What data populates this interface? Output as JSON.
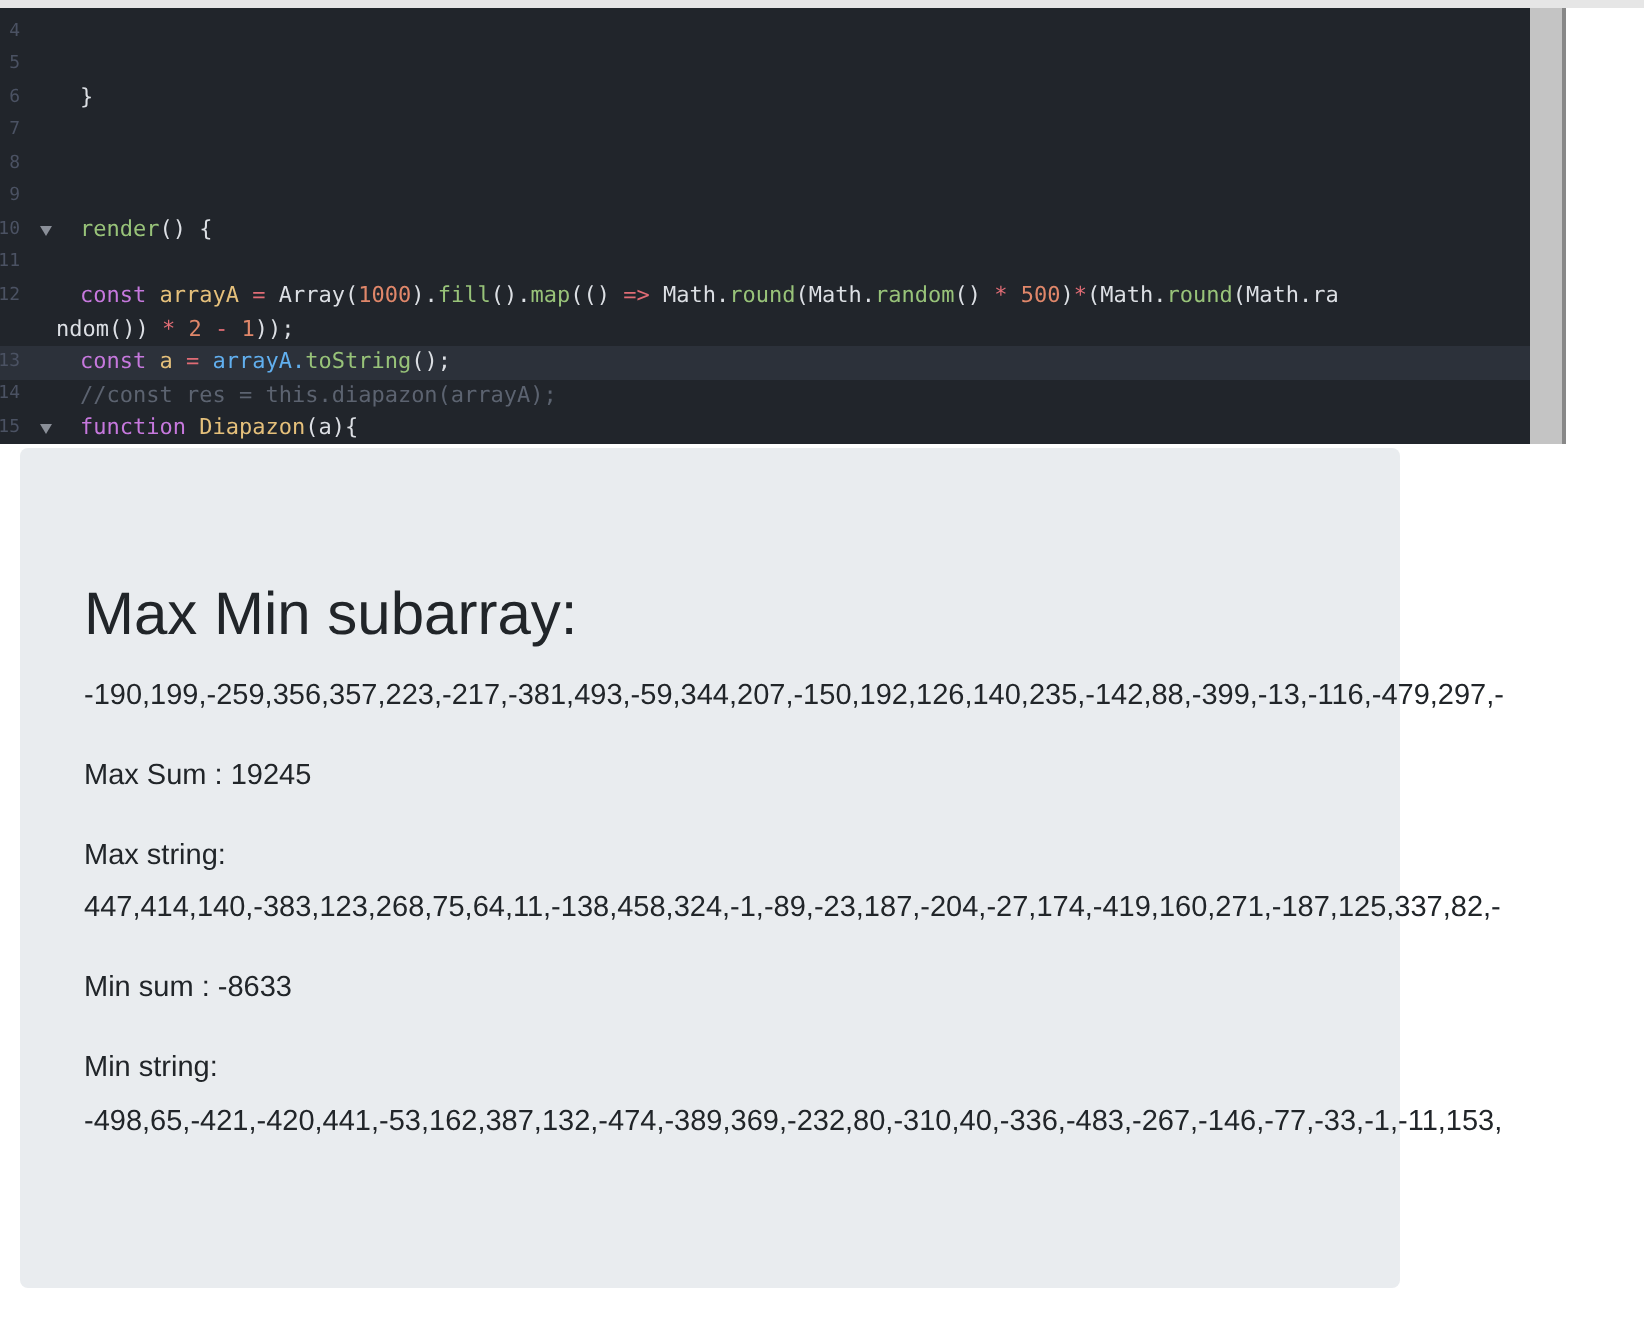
{
  "editor": {
    "lines": [
      {
        "number": "4",
        "fold": false,
        "active": false
      },
      {
        "number": "5",
        "fold": false,
        "active": false
      },
      {
        "number": "6",
        "fold": false,
        "active": false,
        "tokens": [
          {
            "text": "}",
            "kind": "plain"
          }
        ]
      },
      {
        "number": "7",
        "fold": false,
        "active": false
      },
      {
        "number": "8",
        "fold": false,
        "active": false
      },
      {
        "number": "9",
        "fold": false,
        "active": false
      },
      {
        "number": "10",
        "fold": true,
        "active": false,
        "tokens": [
          {
            "text": "render",
            "kind": "function"
          },
          {
            "text": "() {",
            "kind": "plain"
          }
        ]
      },
      {
        "number": "11",
        "fold": false,
        "active": false
      },
      {
        "number": "12",
        "fold": false,
        "active": false,
        "tokens": [
          {
            "text": "const",
            "kind": "keyword"
          },
          {
            "text": " arrayA",
            "kind": "variable"
          },
          {
            "text": " =",
            "kind": "operator"
          },
          {
            "text": " Array(",
            "kind": "plain"
          },
          {
            "text": "1000",
            "kind": "number"
          },
          {
            "text": ").",
            "kind": "plain"
          },
          {
            "text": "fill",
            "kind": "function"
          },
          {
            "text": "().",
            "kind": "plain"
          },
          {
            "text": "map",
            "kind": "function"
          },
          {
            "text": "(()",
            "kind": "plain"
          },
          {
            "text": " =>",
            "kind": "operator"
          },
          {
            "text": " Math.",
            "kind": "plain"
          },
          {
            "text": "round",
            "kind": "function"
          },
          {
            "text": "(Math.",
            "kind": "plain"
          },
          {
            "text": "random",
            "kind": "function"
          },
          {
            "text": "()",
            "kind": "plain"
          },
          {
            "text": " *",
            "kind": "operator"
          },
          {
            "text": " 500",
            "kind": "number"
          },
          {
            "text": ")",
            "kind": "plain"
          },
          {
            "text": "*",
            "kind": "operator"
          },
          {
            "text": "(Math.",
            "kind": "plain"
          },
          {
            "text": "round",
            "kind": "function"
          },
          {
            "text": "(Math.ra",
            "kind": "plain"
          }
        ],
        "wrap": [
          {
            "text": "ndom())",
            "kind": "plain"
          },
          {
            "text": " *",
            "kind": "operator"
          },
          {
            "text": " 2",
            "kind": "number"
          },
          {
            "text": " -",
            "kind": "operator"
          },
          {
            "text": " 1",
            "kind": "number"
          },
          {
            "text": "));",
            "kind": "plain"
          }
        ]
      },
      {
        "number": "13",
        "fold": false,
        "active": true,
        "tokens": [
          {
            "text": "const",
            "kind": "keyword"
          },
          {
            "text": " a",
            "kind": "variable"
          },
          {
            "text": " =",
            "kind": "operator"
          },
          {
            "text": " arrayA.",
            "kind": "property"
          },
          {
            "text": "toString",
            "kind": "function"
          },
          {
            "text": "();",
            "kind": "plain"
          }
        ]
      },
      {
        "number": "14",
        "fold": false,
        "active": false,
        "tokens": [
          {
            "text": "//const res = this.diapazon(arrayA);",
            "kind": "comment"
          }
        ]
      },
      {
        "number": "15",
        "fold": true,
        "active": false,
        "tokens": [
          {
            "text": "function",
            "kind": "keyword"
          },
          {
            "text": " Diapazon",
            "kind": "variable"
          },
          {
            "text": "(a){",
            "kind": "plain"
          }
        ]
      }
    ]
  },
  "result": {
    "title": "Max Min subarray:",
    "array": "-190,199,-259,356,357,223,-217,-381,493,-59,344,207,-150,192,126,140,235,-142,88,-399,-13,-116,-479,297,-",
    "max_sum": "Max Sum : 19245",
    "max_label": "Max string:",
    "max_string": "447,414,140,-383,123,268,75,64,11,-138,458,324,-1,-89,-23,187,-204,-27,174,-419,160,271,-187,125,337,82,-",
    "min_sum": "Min sum : -8633",
    "min_label": "Min string:",
    "min_string": "-498,65,-421,-420,441,-53,162,387,132,-474,-389,369,-232,80,-310,40,-336,-483,-267,-146,-77,-33,-1,-11,153,"
  }
}
